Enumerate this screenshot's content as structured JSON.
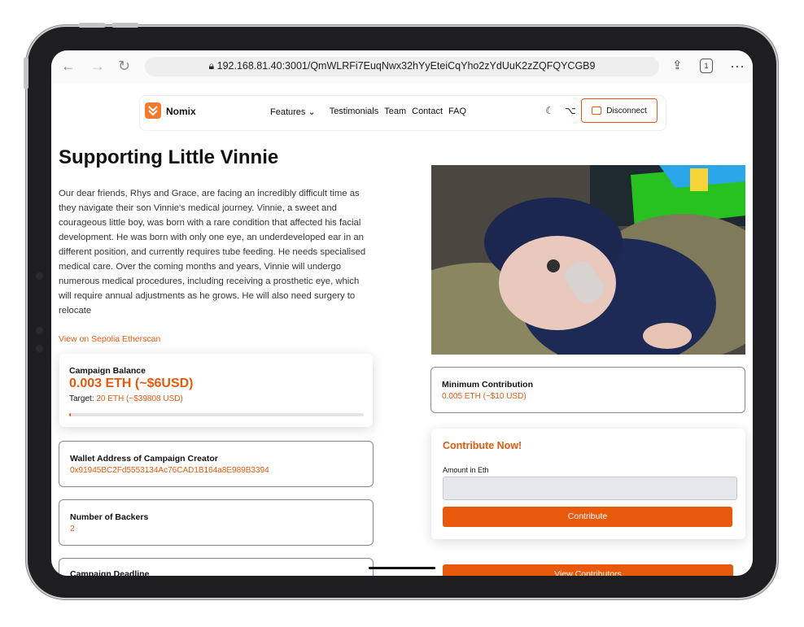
{
  "browser": {
    "url": "192.168.81.40:3001/QmWLRFi7EuqNwx32hYyEteiCqYho2zYdUuK2zZQFQYCGB9",
    "tab_count": "1"
  },
  "nav": {
    "brand": "Nomix",
    "links": [
      "Features ⌄",
      "Testimonials",
      "Team",
      "Contact",
      "FAQ"
    ],
    "disconnect_label": "Disconnect"
  },
  "campaign": {
    "title": "Supporting Little Vinnie",
    "description": "Our dear friends, Rhys and Grace, are facing an incredibly difficult time as they navigate their son Vinnie's medical journey. Vinnie, a sweet and courageous little boy, was born with a rare condition that affected his facial development. He was born with only one eye, an underdeveloped ear in an different position, and currently requires tube feeding. He needs specialised medical care. Over the coming months and years, Vinnie will undergo numerous medical procedures, including receiving a prosthetic eye, which will require annual adjustments as he grows. He will also need surgery to relocate",
    "etherscan_link": "View on Sepolia Etherscan"
  },
  "balance": {
    "label": "Campaign Balance",
    "amount": "0.003 ETH (~$6USD)",
    "target_label": "Target:",
    "target_value": "20 ETH (~$39808 USD)",
    "progress_fraction": 0.00015
  },
  "wallet": {
    "label": "Wallet Address of Campaign Creator",
    "address": "0x91945BC2Fd5553134Ac76CAD1B164a8E989B3394"
  },
  "backers": {
    "label": "Number of Backers",
    "count": "2"
  },
  "deadline": {
    "label": "Campaign Deadline"
  },
  "min_contribution": {
    "label": "Minimum Contribution",
    "value": "0.005 ETH (~$10 USD)"
  },
  "contribute": {
    "heading": "Contribute Now!",
    "amount_label": "Amount in Eth",
    "amount_value": "",
    "button_label": "Contribute",
    "view_contributors_label": "View Contributors"
  },
  "colors": {
    "accent": "#e8590c",
    "logo": "#f47a2a"
  }
}
